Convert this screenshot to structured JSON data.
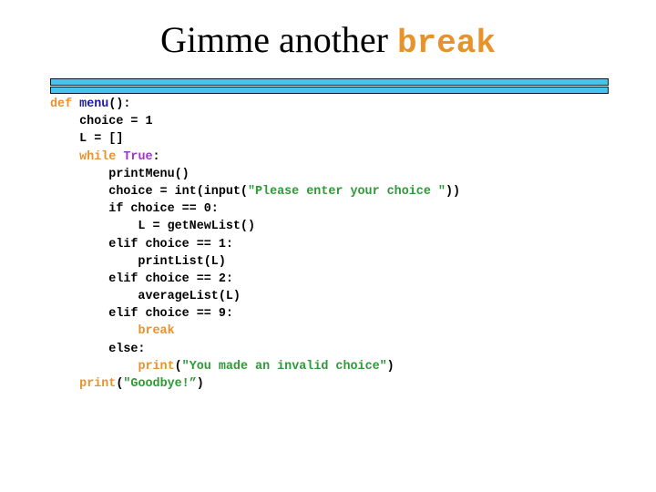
{
  "slide": {
    "title": {
      "text": "Gimme another ",
      "keyword": "break"
    },
    "colors": {
      "keyword": "#e8922a",
      "function_name": "#1a1aa0",
      "boolean": "#a035c8",
      "string": "#2e9a35",
      "default": "#000000",
      "rule_fill": "#45c3ec",
      "rule_border": "#0a1a2a"
    },
    "code": {
      "lines": [
        [
          {
            "t": "def",
            "c": "kw"
          },
          {
            "t": " "
          },
          {
            "t": "menu",
            "c": "fn"
          },
          {
            "t": "():"
          }
        ],
        [
          {
            "t": "    choice = 1"
          }
        ],
        [
          {
            "t": "    L = []"
          }
        ],
        [
          {
            "t": "    "
          },
          {
            "t": "while",
            "c": "kw"
          },
          {
            "t": " "
          },
          {
            "t": "True",
            "c": "bool"
          },
          {
            "t": ":"
          }
        ],
        [
          {
            "t": "        printMenu()"
          }
        ],
        [
          {
            "t": "        choice = int(input("
          },
          {
            "t": "\"Please enter your choice \"",
            "c": "str"
          },
          {
            "t": "))"
          }
        ],
        [
          {
            "t": "        if choice == 0:"
          }
        ],
        [
          {
            "t": "            L = getNewList()"
          }
        ],
        [
          {
            "t": "        elif choice == 1:"
          }
        ],
        [
          {
            "t": "            printList(L)"
          }
        ],
        [
          {
            "t": "        elif choice == 2:"
          }
        ],
        [
          {
            "t": "            averageList(L)"
          }
        ],
        [
          {
            "t": "        elif choice == 9:"
          }
        ],
        [
          {
            "t": "            "
          },
          {
            "t": "break",
            "c": "kw"
          }
        ],
        [
          {
            "t": "        else:"
          }
        ],
        [
          {
            "t": "            "
          },
          {
            "t": "print",
            "c": "kw"
          },
          {
            "t": "("
          },
          {
            "t": "\"You made an invalid choice\"",
            "c": "str"
          },
          {
            "t": ")"
          }
        ],
        [
          {
            "t": "    "
          },
          {
            "t": "print",
            "c": "kw"
          },
          {
            "t": "("
          },
          {
            "t": "\"Goodbye!”",
            "c": "str"
          },
          {
            "t": ")"
          }
        ]
      ]
    }
  }
}
